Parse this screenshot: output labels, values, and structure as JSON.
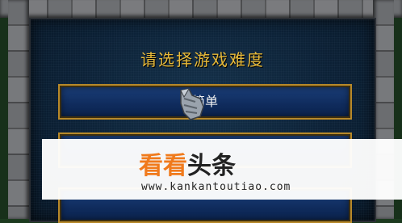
{
  "dialog": {
    "title": "请选择游戏难度",
    "buttons": [
      {
        "label": "简单"
      },
      {
        "label": ""
      },
      {
        "label": ""
      }
    ]
  },
  "watermark": {
    "logo_part1": "看看",
    "logo_part2": "头条",
    "url": "www.kankantoutiao.com"
  },
  "colors": {
    "title_gold": "#e6b93a",
    "button_border_gold": "#b7892a",
    "panel_navy": "#0c2136",
    "watermark_orange": "#f07a1c"
  },
  "icons": {
    "cursor": "gauntlet-cursor-icon"
  }
}
